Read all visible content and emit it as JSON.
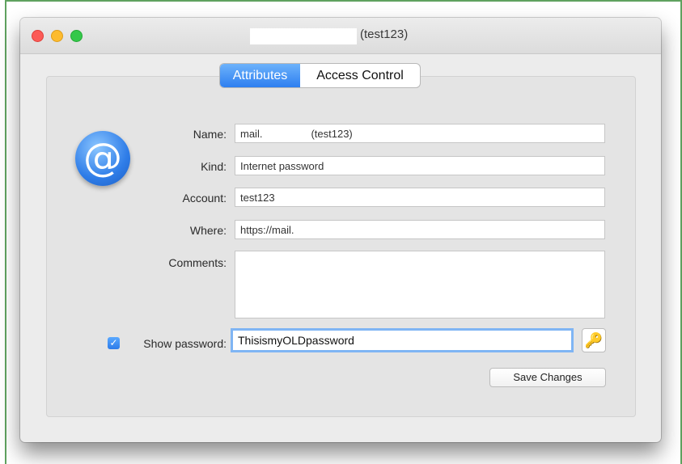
{
  "window": {
    "title": "(test123)"
  },
  "tabs": [
    {
      "label": "Attributes",
      "active": true
    },
    {
      "label": "Access Control",
      "active": false
    }
  ],
  "icon": {
    "name": "at-sign-icon",
    "glyph": "@"
  },
  "fields": {
    "name": {
      "label": "Name:",
      "value_prefix": "mail.",
      "value_suffix": "(test123)"
    },
    "kind": {
      "label": "Kind:",
      "value": "Internet password"
    },
    "account": {
      "label": "Account:",
      "value": "test123"
    },
    "where": {
      "label": "Where:",
      "value": "https://mail."
    },
    "comments": {
      "label": "Comments:",
      "value": ""
    }
  },
  "password": {
    "checkbox_label": "Show password:",
    "checked": true,
    "value": "ThisismyOLDpassword",
    "key_glyph": "🔑"
  },
  "buttons": {
    "save": "Save Changes"
  },
  "colors": {
    "accent": "#2e7ff0",
    "focus_ring": "#7fb5f4"
  }
}
